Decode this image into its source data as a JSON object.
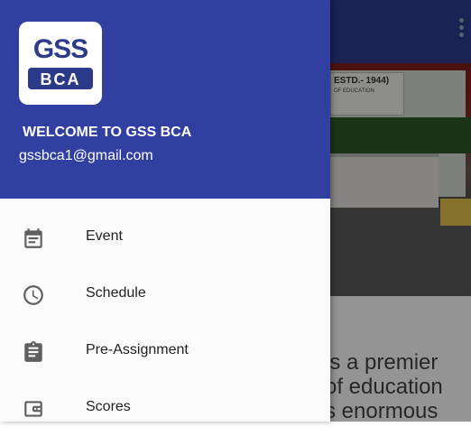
{
  "background": {
    "sign_title": "ESTD.- 1944)",
    "sign_subtitle": "OF EDUCATION",
    "body_text": [
      "is a premier",
      "of education",
      "s enormous"
    ]
  },
  "drawer": {
    "logo_text_top": "GSS",
    "logo_text_bottom": "BCA",
    "welcome": "WELCOME TO GSS BCA",
    "email": "gssbca1@gmail.com",
    "items": [
      {
        "label": "Event",
        "icon": "calendar-icon"
      },
      {
        "label": "Schedule",
        "icon": "clock-icon"
      },
      {
        "label": "Pre-Assignment",
        "icon": "clipboard-icon"
      },
      {
        "label": "Scores",
        "icon": "wallet-icon"
      }
    ]
  },
  "colors": {
    "header": "#3140a0",
    "toolbar": "#2f3b91",
    "icon": "#5f5f5f"
  }
}
